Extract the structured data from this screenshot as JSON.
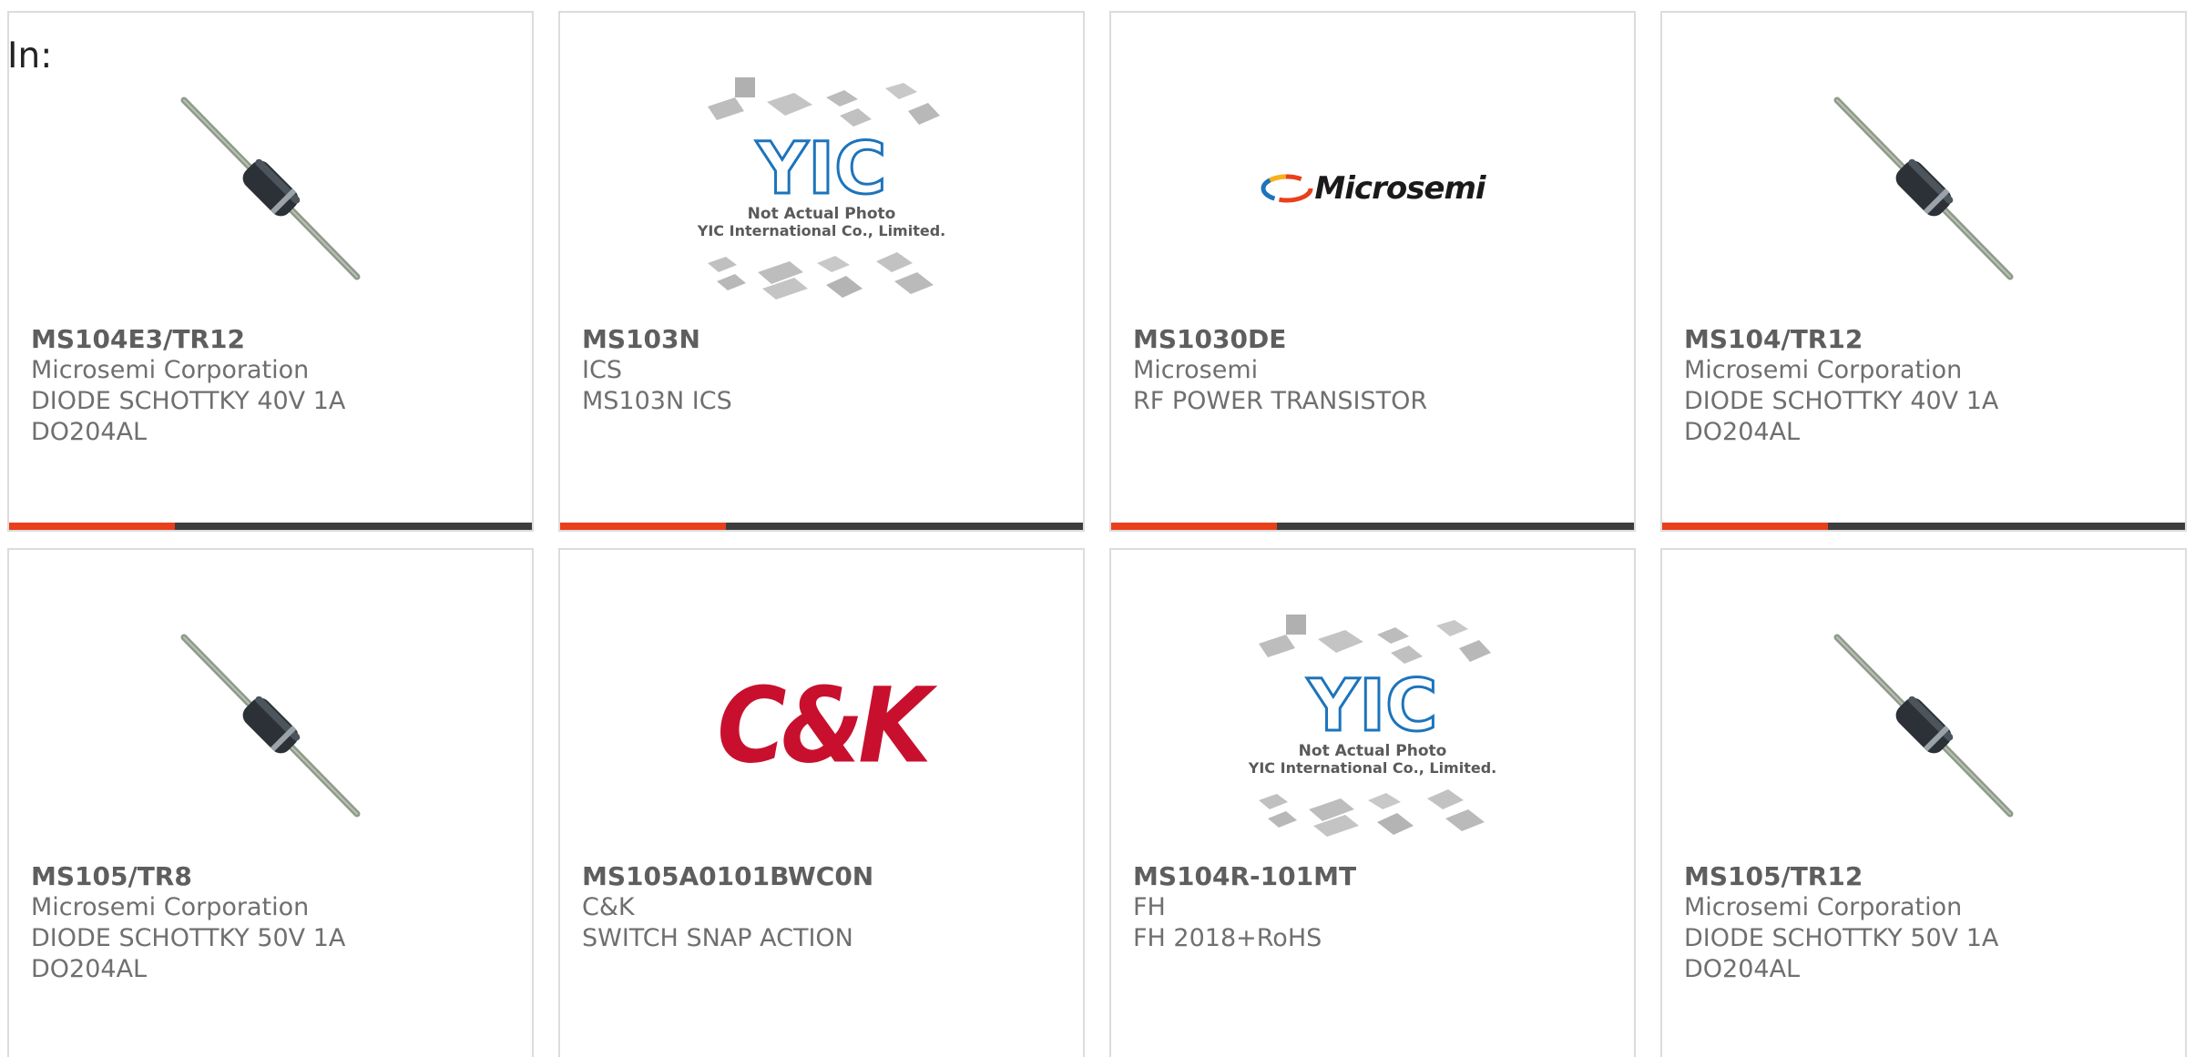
{
  "filter": {
    "label": "In:"
  },
  "products": [
    {
      "part_number": "MS104E3/TR12",
      "manufacturer": "Microsemi Corporation",
      "description": "DIODE SCHOTTKY 40V 1A",
      "package": "DO204AL",
      "image": "diode-image"
    },
    {
      "part_number": "MS103N",
      "manufacturer": "ICS",
      "description": "MS103N ICS",
      "package": "",
      "image": "yic-placeholder-image"
    },
    {
      "part_number": "MS1030DE",
      "manufacturer": "Microsemi",
      "description": "RF POWER TRANSISTOR",
      "package": "",
      "image": "microsemi-logo"
    },
    {
      "part_number": "MS104/TR12",
      "manufacturer": "Microsemi Corporation",
      "description": "DIODE SCHOTTKY 40V 1A",
      "package": "DO204AL",
      "image": "diode-image"
    },
    {
      "part_number": "MS105/TR8",
      "manufacturer": "Microsemi Corporation",
      "description": "DIODE SCHOTTKY 50V 1A",
      "package": "DO204AL",
      "image": "diode-image"
    },
    {
      "part_number": "MS105A0101BWC0N",
      "manufacturer": "C&K",
      "description": "SWITCH SNAP ACTION",
      "package": "",
      "image": "ck-logo"
    },
    {
      "part_number": "MS104R-101MT",
      "manufacturer": "FH",
      "description": "FH 2018+RoHS",
      "package": "",
      "image": "yic-placeholder-image"
    },
    {
      "part_number": "MS105/TR12",
      "manufacturer": "Microsemi Corporation",
      "description": "DIODE SCHOTTKY 50V 1A",
      "package": "DO204AL",
      "image": "diode-image"
    }
  ],
  "placeholder": {
    "logo_text": "YIC",
    "line1": "Not Actual Photo",
    "line2": "YIC International Co., Limited."
  },
  "logos": {
    "microsemi": "Microsemi",
    "ck": "C&K"
  },
  "colors": {
    "accent": "#e8401c",
    "bar": "#3d3d3d",
    "text": "#6f6f6f",
    "border": "#dcdcdc",
    "yic_blue": "#1c74bc",
    "ck_red": "#c8102e"
  }
}
